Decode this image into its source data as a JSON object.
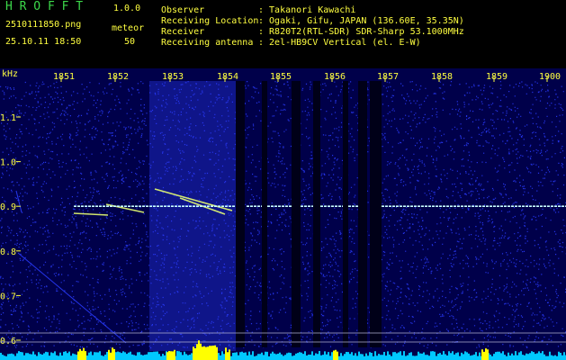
{
  "header": {
    "logo": "H R O F F T",
    "version": "1.0.0",
    "filename": "2510111850.png",
    "datetime": "25.10.11 18:50",
    "meteor_label": "meteor",
    "meteor_count": "50"
  },
  "station_info": [
    {
      "label": "Observer",
      "value": ": Takanori Kawachi"
    },
    {
      "label": "Receiving Location",
      "value": ": Ogaki, Gifu, JAPAN (136.60E, 35.35N)"
    },
    {
      "label": "Receiver",
      "value": ": R820T2(RTL-SDR) SDR-Sharp 53.1000MHz"
    },
    {
      "label": "Receiving antenna",
      "value": ": 2el-HB9CV Vertical (el. E-W)"
    }
  ],
  "spectrogram": {
    "y_unit": "kHz",
    "y_ticks": [
      "1.1",
      "1.0",
      "0.9",
      "0.8",
      "0.7",
      "0.6"
    ],
    "x_ticks": [
      "1851",
      "1852",
      "1853",
      "1854",
      "1855",
      "1856",
      "1857",
      "1858",
      "1859",
      "1900"
    ],
    "carrier_khz": 0.9,
    "colors": {
      "background": "#00004a",
      "noise": "#2a3cff",
      "echo": "#e8ff70",
      "carrier": "#c8ffff",
      "gap": "#000018",
      "ticks": "#ffff40",
      "activity": "#00c8ff",
      "activity_peak": "#ffff00"
    }
  }
}
